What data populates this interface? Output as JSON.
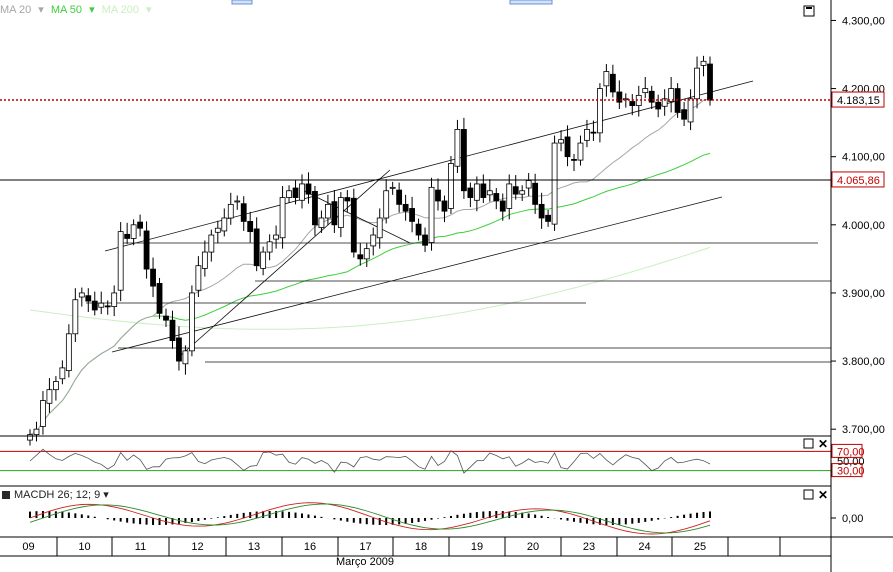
{
  "legend": {
    "ma20": "MA 20",
    "ma50": "MA 50",
    "ma200": "MA 200",
    "ma20_color": "#a6a6a6",
    "ma50_color": "#3ccf3c",
    "ma200_color": "#c8f0c0"
  },
  "macd_label": "MACDH 26; 12; 9",
  "x_period_label": "Março 2009",
  "price_axis": {
    "ticks": [
      "4.300,00",
      "4.200,00",
      "4.100,00",
      "4.000,00",
      "3.900,00",
      "3.800,00",
      "3.700,00"
    ],
    "current_price_label": "4.183,15",
    "level_label": "4.065,86"
  },
  "rsi_axis": {
    "upper_label": "70,00",
    "mid_label": "50,00",
    "lower_label": "30,00"
  },
  "macd_axis": {
    "zero_label": "0,00"
  },
  "chart_data": {
    "type": "candlestick",
    "title": "",
    "x_ticks": [
      "09",
      "10",
      "11",
      "12",
      "13",
      "16",
      "17",
      "18",
      "19",
      "20",
      "23",
      "24",
      "25"
    ],
    "series": [
      {
        "name": "MA 20"
      },
      {
        "name": "MA 50"
      },
      {
        "name": "MA 200"
      }
    ],
    "ohlc_closes": [
      3692,
      3700,
      3742,
      3758,
      3770,
      3790,
      3840,
      3890,
      3900,
      3888,
      3875,
      3885,
      3880,
      3900,
      3990,
      3980,
      4000,
      3995,
      3935,
      3910,
      3870,
      3860,
      3830,
      3800,
      3815,
      3900,
      3940,
      3960,
      3985,
      3995,
      4010,
      4030,
      4035,
      4005,
      3990,
      3940,
      3960,
      3975,
      3985,
      4040,
      4050,
      4040,
      4060,
      4045,
      4000,
      4010,
      4030,
      4000,
      4040,
      4035,
      3960,
      3950,
      3965,
      3985,
      4010,
      4050,
      4055,
      4030,
      4020,
      4005,
      3985,
      3970,
      4055,
      4035,
      4020,
      4090,
      4140,
      4050,
      4040,
      4060,
      4040,
      4050,
      4035,
      4020,
      4060,
      4045,
      4050,
      4065,
      4030,
      4010,
      4005,
      4120,
      4125,
      4100,
      4095,
      4120,
      4140,
      4135,
      4200,
      4225,
      4195,
      4180,
      4185,
      4175,
      4190,
      4200,
      4180,
      4170,
      4185,
      4200,
      4165,
      4155,
      4185,
      4230,
      4240,
      4183
    ],
    "price_ylim": [
      3690,
      4330
    ],
    "current_price": 4183.15,
    "horizontal_level": 4065.86,
    "rsi": {
      "upper": 70,
      "lower": 30,
      "mid": 50
    },
    "macd_zero": 0
  }
}
